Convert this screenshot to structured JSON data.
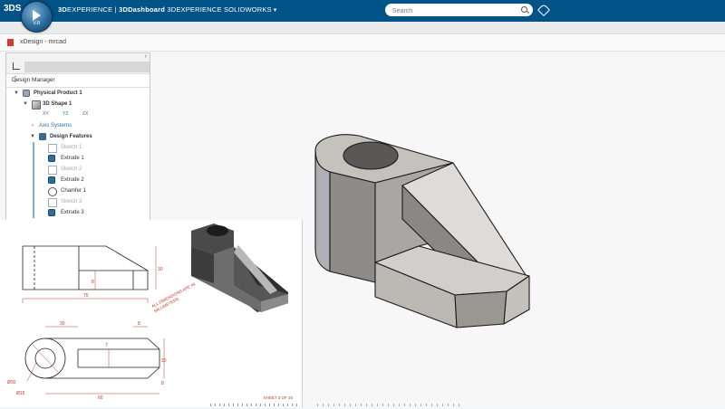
{
  "topbar": {
    "brand": "3DS",
    "compass_version": "V.R",
    "title_prefix": "3D",
    "title_main": "EXPERIENCE | ",
    "dashboard": "3DDashboard",
    "app": " 3DEXPERIENCE SOLIDWORKS",
    "chevron": "▾",
    "search_placeholder": "Search"
  },
  "document": {
    "title": "xDesign - mrcad"
  },
  "tree": {
    "header": "Design Manager",
    "menu": "⋮",
    "collapse": "‹",
    "nodes": [
      {
        "label": "Physical Product 1"
      },
      {
        "label": "3D Shape 1"
      },
      {
        "label": "Axis Systems"
      },
      {
        "label": "Design Features"
      },
      {
        "label": "Sketch 1"
      },
      {
        "label": "Extrude 1"
      },
      {
        "label": "Sketch 2"
      },
      {
        "label": "Extrude 2"
      },
      {
        "label": "Chamfer 1"
      },
      {
        "label": "Sketch 3"
      },
      {
        "label": "Extrude 3"
      }
    ],
    "planes": [
      "XY",
      "YZ",
      "ZX"
    ]
  },
  "drawing": {
    "dim_top_width": "75",
    "dim_height": "30",
    "dim_mid": "8",
    "dim_plan_left": "30",
    "dim_plan_right": "8",
    "dim_plan_total": "60",
    "dim_plan_h1": "20",
    "dim_plan_h2": "8",
    "dim_dia_outer": "Ø30",
    "dim_dia_inner": "Ø15",
    "dim_small": "7",
    "annotation": "ALL DIMENSIONS ARE IN MILLIMETERS",
    "sheet": "SHEET 3 OF 25"
  },
  "colors": {
    "topbar": "#005386",
    "model_face": "#c8c5c1",
    "model_dark": "#8f8c88"
  }
}
